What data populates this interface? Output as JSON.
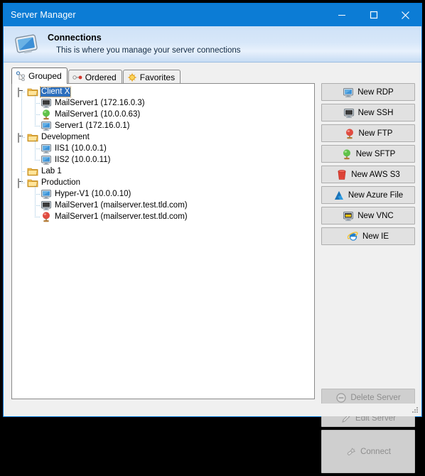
{
  "window": {
    "title": "Server Manager",
    "controls": [
      {
        "name": "minimize",
        "label": "—"
      },
      {
        "name": "maximize",
        "label": "□"
      },
      {
        "name": "close",
        "label": "✕"
      }
    ]
  },
  "header": {
    "icon": "monitor-icon",
    "title": "Connections",
    "subtitle": "This is where you manage your server connections"
  },
  "tabs": [
    {
      "label": "Grouped",
      "icon": "hierarchy-icon",
      "active": true
    },
    {
      "label": "Ordered",
      "icon": "ordered-list-icon",
      "active": false
    },
    {
      "label": "Favorites",
      "icon": "star-sun-icon",
      "active": false
    }
  ],
  "tree": [
    {
      "label": "Client X",
      "icon": "folder-icon",
      "depth": 0,
      "expander": "minus",
      "selected": true
    },
    {
      "label": "MailServer1 (172.16.0.3)",
      "icon": "ssh-monitor-icon",
      "depth": 1,
      "expander": "none",
      "selected": false
    },
    {
      "label": "MailServer1 (10.0.0.63)",
      "icon": "sftp-green-icon",
      "depth": 1,
      "expander": "none",
      "selected": false
    },
    {
      "label": "Server1 (172.16.0.1)",
      "icon": "rdp-monitor-icon",
      "depth": 1,
      "expander": "none",
      "selected": false
    },
    {
      "label": "Development",
      "icon": "folder-icon",
      "depth": 0,
      "expander": "minus",
      "selected": false
    },
    {
      "label": "IIS1 (10.0.0.1)",
      "icon": "rdp-monitor-icon",
      "depth": 1,
      "expander": "none",
      "selected": false
    },
    {
      "label": "IIS2 (10.0.0.11)",
      "icon": "rdp-monitor-icon",
      "depth": 1,
      "expander": "none",
      "selected": false
    },
    {
      "label": "Lab 1",
      "icon": "folder-icon",
      "depth": 0,
      "expander": "none",
      "selected": false
    },
    {
      "label": "Production",
      "icon": "folder-icon",
      "depth": 0,
      "expander": "minus",
      "selected": false
    },
    {
      "label": "Hyper-V1 (10.0.0.10)",
      "icon": "rdp-monitor-icon",
      "depth": 1,
      "expander": "none",
      "selected": false
    },
    {
      "label": "MailServer1 (mailserver.test.tld.com)",
      "icon": "ssh-monitor-icon",
      "depth": 1,
      "expander": "none",
      "selected": false
    },
    {
      "label": "MailServer1 (mailserver.test.tld.com)",
      "icon": "ftp-red-icon",
      "depth": 1,
      "expander": "none",
      "selected": false
    }
  ],
  "new_buttons": [
    {
      "label": "New RDP",
      "icon": "rdp-monitor-icon"
    },
    {
      "label": "New SSH",
      "icon": "ssh-monitor-icon"
    },
    {
      "label": "New FTP",
      "icon": "ftp-red-icon"
    },
    {
      "label": "New SFTP",
      "icon": "sftp-green-icon"
    },
    {
      "label": "New AWS S3",
      "icon": "aws-bucket-icon"
    },
    {
      "label": "New Azure File",
      "icon": "azure-triangle-icon"
    },
    {
      "label": "New VNC",
      "icon": "vnc-monitor-icon"
    },
    {
      "label": "New IE",
      "icon": "internet-explorer-icon"
    }
  ],
  "action_buttons": [
    {
      "label": "Delete Server",
      "icon": "delete-circle-icon",
      "enabled": false
    },
    {
      "label": "Edit Server",
      "icon": "pencil-icon",
      "enabled": false
    },
    {
      "label": "Connect",
      "icon": "plug-icon",
      "enabled": false
    }
  ],
  "colors": {
    "titlebar": "#0c7cd5",
    "accent": "#0078d7",
    "selection": "#2d6fbd",
    "header_band_top": "#cfe2f7",
    "button_face": "#e1e1e1",
    "panel": "#f0f0f0"
  }
}
